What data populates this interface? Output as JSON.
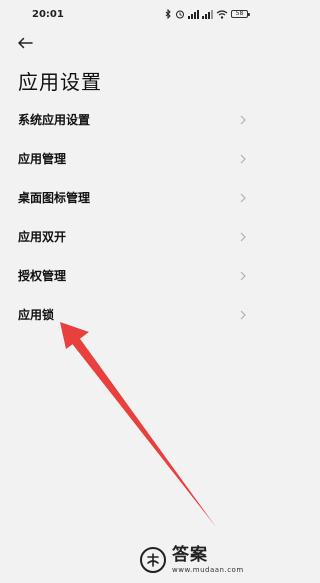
{
  "status_bar": {
    "time": "20:01",
    "battery": "58",
    "icons": [
      "bluetooth-icon",
      "alarm-icon",
      "signal-icon",
      "signal-icon",
      "wifi-icon",
      "battery-icon"
    ]
  },
  "header": {
    "back_icon": "back-arrow-icon",
    "title": "应用设置"
  },
  "list": {
    "items": [
      {
        "label": "系统应用设置"
      },
      {
        "label": "应用管理"
      },
      {
        "label": "桌面图标管理"
      },
      {
        "label": "应用双开"
      },
      {
        "label": "授权管理"
      },
      {
        "label": "应用锁"
      }
    ]
  },
  "annotation": {
    "color": "#e8403c"
  },
  "watermark": {
    "name": "答案",
    "url": "www.mudaan.com"
  }
}
